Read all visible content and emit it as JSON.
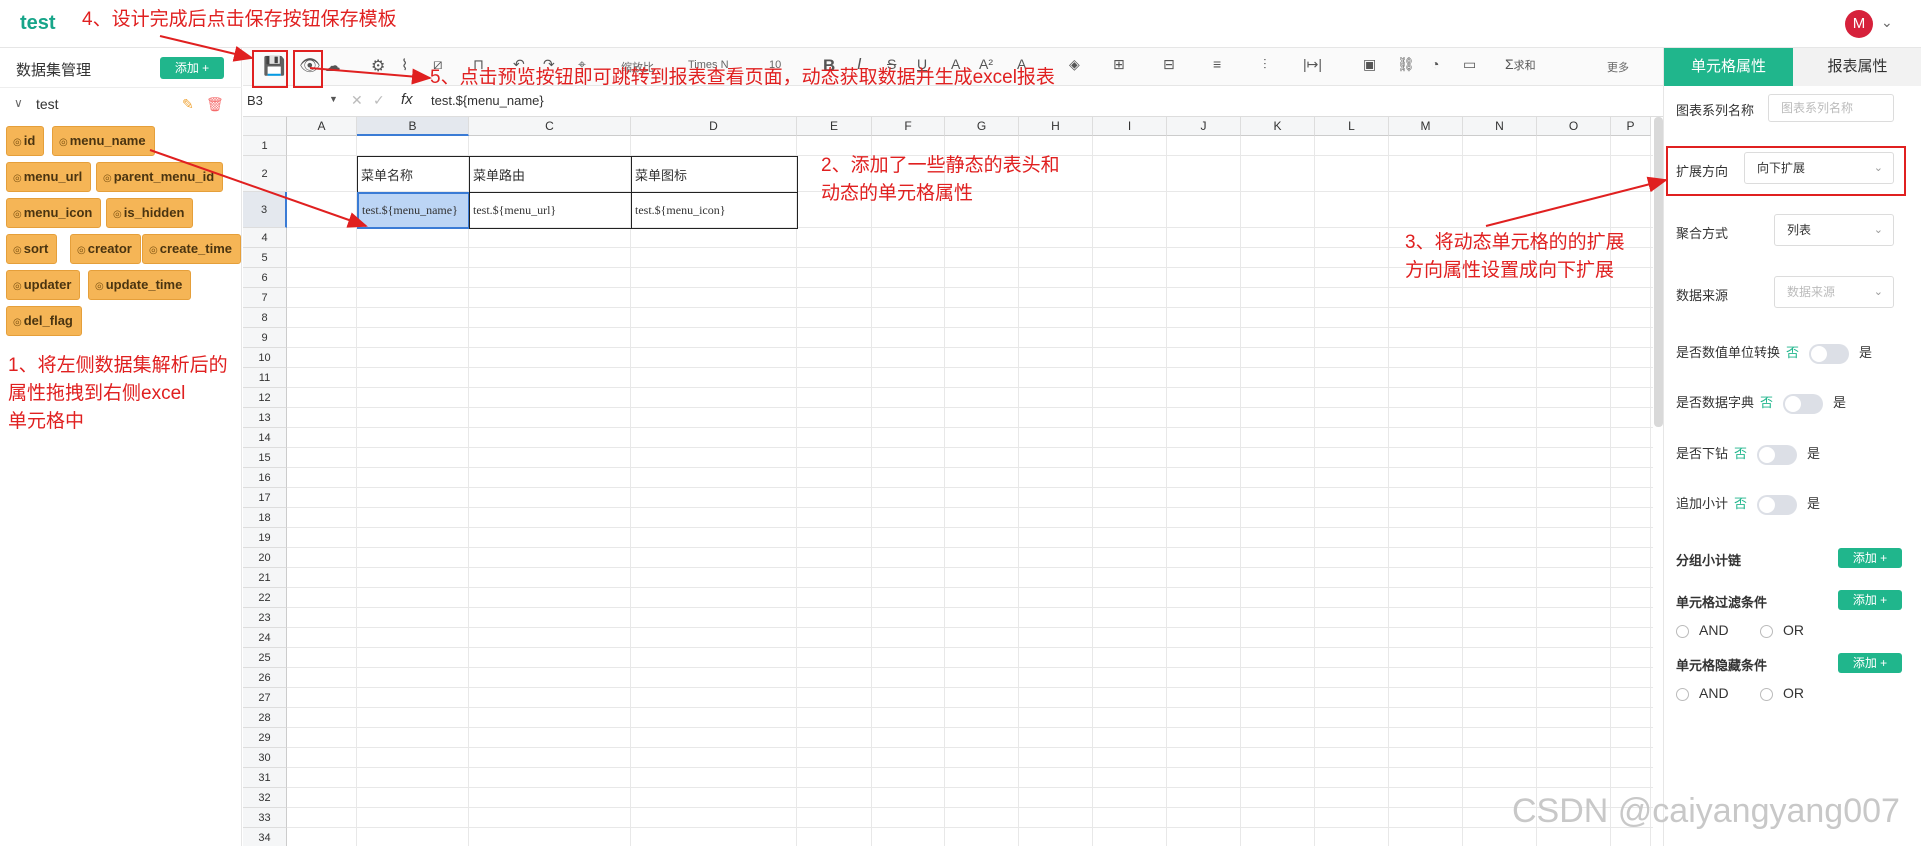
{
  "app": {
    "title": "test",
    "avatar_letter": "M"
  },
  "left_panel": {
    "title": "数据集管理",
    "add_label": "添加 +",
    "dataset": {
      "name": "test"
    },
    "fields": [
      "id",
      "menu_name",
      "menu_url",
      "parent_menu_id",
      "menu_icon",
      "is_hidden",
      "sort",
      "creator",
      "create_time",
      "updater",
      "update_time",
      "del_flag"
    ]
  },
  "toolbar": {
    "font_size_shrink": "缩放比",
    "font_family": "Times N",
    "font_size": "10",
    "bold": "B",
    "italic": "I",
    "sum_label": "求和",
    "more_label": "更多"
  },
  "formula_bar": {
    "cell_ref": "B3",
    "fx": "fx",
    "value": "test.${menu_name}"
  },
  "sheet": {
    "columns": [
      "A",
      "B",
      "C",
      "D",
      "E",
      "F",
      "G",
      "H",
      "I",
      "J",
      "K",
      "L",
      "M",
      "N",
      "O",
      "P"
    ],
    "selected_column": "B",
    "selected_row": 3,
    "row_count": 34,
    "header_cells": {
      "B2": "菜单名称",
      "C2": "菜单路由",
      "D2": "菜单图标"
    },
    "data_cells": {
      "B3": "test.${menu_name}",
      "C3": "test.${menu_url}",
      "D3": "test.${menu_icon}"
    }
  },
  "right_panel": {
    "tab_cell": "单元格属性",
    "tab_report": "报表属性",
    "series_name_label": "图表系列名称",
    "series_name_placeholder": "图表系列名称",
    "expand_label": "扩展方向",
    "expand_value": "向下扩展",
    "agg_label": "聚合方式",
    "agg_value": "列表",
    "source_label": "数据来源",
    "source_placeholder": "数据来源",
    "toggles": [
      {
        "label": "是否数值单位转换",
        "no": "否",
        "yes": "是"
      },
      {
        "label": "是否数据字典",
        "no": "否",
        "yes": "是"
      },
      {
        "label": "是否下钻",
        "no": "否",
        "yes": "是"
      },
      {
        "label": "追加小计",
        "no": "否",
        "yes": "是"
      }
    ],
    "group_subtotal": "分组小计链",
    "filter_title": "单元格过滤条件",
    "hide_title": "单元格隐藏条件",
    "add_label": "添加 +",
    "and_label": "AND",
    "or_label": "OR"
  },
  "annotations": {
    "a1_line1": "1、将左侧数据集解析后的",
    "a1_line2": "属性拖拽到右侧excel",
    "a1_line3": "单元格中",
    "a2_line1": "2、添加了一些静态的表头和",
    "a2_line2": "动态的单元格属性",
    "a3_line1": "3、将动态单元格的的扩展",
    "a3_line2": "方向属性设置成向下扩展",
    "a4": "4、设计完成后点击保存按钮保存模板",
    "a5": "5、点击预览按钮即可跳转到报表查看页面，动态获取数据并生成excel报表"
  },
  "watermark": "CSDN @caiyangyang007"
}
